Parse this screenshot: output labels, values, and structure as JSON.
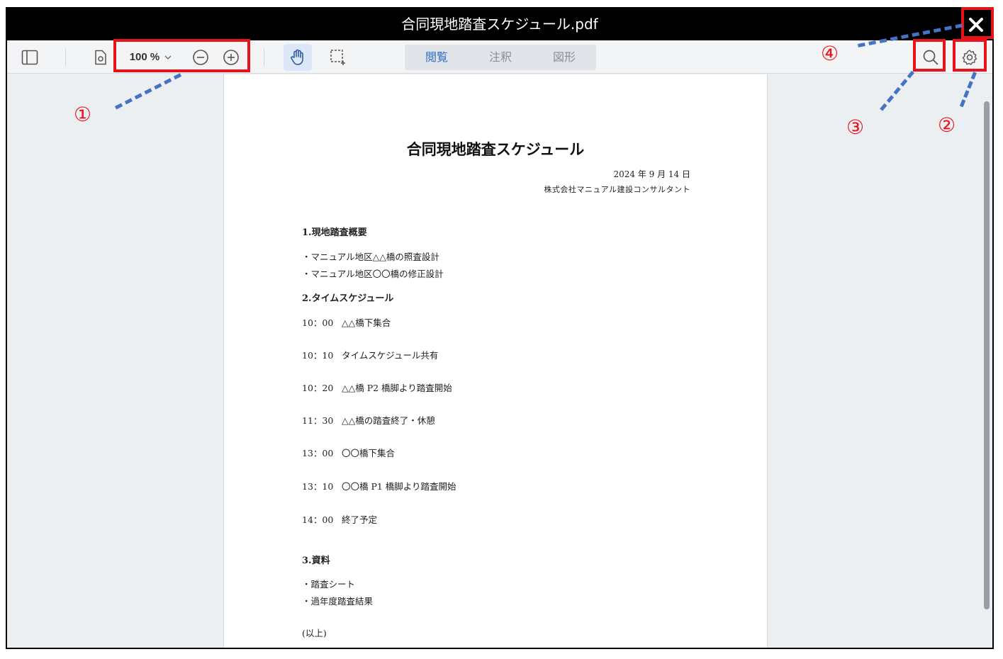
{
  "window": {
    "title": "合同現地踏査スケジュール.pdf"
  },
  "toolbar": {
    "zoom_value": "100 %",
    "tabs": [
      {
        "label": "閲覧"
      },
      {
        "label": "注釈"
      },
      {
        "label": "図形"
      }
    ]
  },
  "document": {
    "title": "合同現地踏査スケジュール",
    "date": "2024 年 9 月 14 日",
    "company": "株式会社マニュアル建設コンサルタント",
    "section1": {
      "heading": "1.現地踏査概要",
      "items": [
        "・マニュアル地区△△橋の照査設計",
        "・マニュアル地区〇〇橋の修正設計"
      ]
    },
    "section2": {
      "heading": "2.タイムスケジュール",
      "schedule": [
        {
          "time": "10：00",
          "text": "△△橋下集合"
        },
        {
          "time": "10：10",
          "text": "タイムスケジュール共有"
        },
        {
          "time": "10：20",
          "text": "△△橋 P2 橋脚より踏査開始"
        },
        {
          "time": "11：30",
          "text": "△△橋の踏査終了・休憩"
        },
        {
          "time": "13：00",
          "text": "〇〇橋下集合"
        },
        {
          "time": "13：10",
          "text": "〇〇橋 P1 橋脚より踏査開始"
        },
        {
          "time": "14：00",
          "text": "終了予定"
        }
      ]
    },
    "section3": {
      "heading": "3.資料",
      "items": [
        "・踏査シート",
        "・過年度踏査結果"
      ]
    },
    "end_note": "(以上)"
  },
  "annotations": {
    "markers": [
      "①",
      "②",
      "③",
      "④"
    ],
    "highlight_color": "#e8121b",
    "leader_color": "#4472c4"
  }
}
